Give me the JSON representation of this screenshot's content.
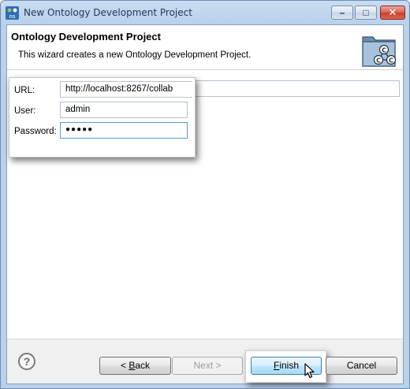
{
  "window": {
    "title": "New Ontology Development Project",
    "app_icon": "ontology-studio-icon"
  },
  "titlebar_buttons": {
    "minimize_glyph": "–",
    "maximize_glyph": "□",
    "close_glyph": "✕"
  },
  "banner": {
    "title": "Ontology Development Project",
    "description": "This wizard creates a new Ontology Development Project.",
    "image_icon": "ontology-project-wizard-icon"
  },
  "form": {
    "url_label": "URL:",
    "url_value": "http://localhost:8267/collab",
    "user_label": "User:",
    "user_value": "admin",
    "password_label": "Password:",
    "password_value": "●●●●●"
  },
  "buttons": {
    "help": "?",
    "back_prefix": "< ",
    "back_mnemonic": "B",
    "back_rest": "ack",
    "next_label": "Next >",
    "finish_mnemonic": "F",
    "finish_rest": "inish",
    "cancel_label": "Cancel"
  },
  "colors": {
    "title_bar": "#c9dcf1",
    "close_button": "#d9624e",
    "default_button": "#bee6fd",
    "button_bar": "#f0f0f0"
  }
}
